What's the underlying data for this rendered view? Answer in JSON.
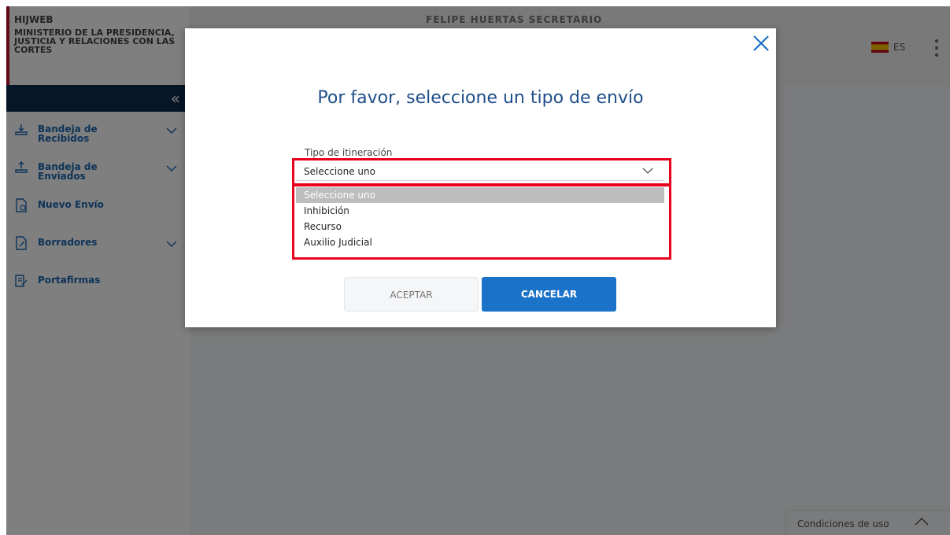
{
  "app": {
    "brand_name": "HIJWEB",
    "ministry": "MINISTERIO DE LA PRESIDENCIA, JUSTICIA Y RELACIONES CON LAS CORTES",
    "user": "FELIPE HUERTAS SECRETARIO",
    "language": "ES"
  },
  "sidebar": {
    "items": [
      {
        "label": "Bandeja de Recibidos"
      },
      {
        "label": "Bandeja de Enviados"
      },
      {
        "label": "Nuevo Envío"
      },
      {
        "label": "Borradores"
      },
      {
        "label": "Portafirmas"
      }
    ]
  },
  "footer": {
    "conditions": "Condiciones de uso"
  },
  "modal": {
    "title": "Por favor, seleccione un tipo de envío",
    "field_label": "Tipo de itineración",
    "selected_value": "Seleccione uno",
    "options": [
      "Seleccione uno",
      "Inhibición",
      "Recurso",
      "Auxilio Judicial"
    ],
    "accept": "ACEPTAR",
    "cancel": "CANCELAR"
  },
  "colors": {
    "primary": "#1a73c8",
    "highlight": "#e8001c",
    "sidebar_dark": "#0b2d4f"
  }
}
